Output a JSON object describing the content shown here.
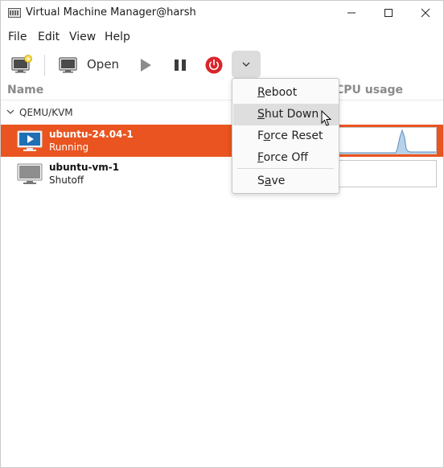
{
  "window": {
    "title": "Virtual Machine Manager@harsh",
    "icon": "vm-manager-icon",
    "controls": [
      "minimize-icon",
      "maximize-icon",
      "close-icon"
    ]
  },
  "menubar": {
    "items": [
      {
        "label": "File"
      },
      {
        "label": "Edit"
      },
      {
        "label": "View"
      },
      {
        "label": "Help"
      }
    ]
  },
  "toolbar": {
    "new_vm_icon": "new-vm-icon",
    "open_label": "Open",
    "run_icon": "play-icon",
    "pause_icon": "pause-icon",
    "shutdown_icon": "power-icon",
    "menu_icon": "chevron-down-icon",
    "shutdown_color": "#d9252a"
  },
  "columns": {
    "name": "Name",
    "cpu": "CPU usage"
  },
  "connection": {
    "label": "QEMU/KVM"
  },
  "vms": [
    {
      "name": "ubuntu-24.04-1",
      "status": "Running",
      "selected": true,
      "icon": "running-vm-icon"
    },
    {
      "name": "ubuntu-vm-1",
      "status": "Shutoff",
      "selected": false,
      "icon": "shutoff-vm-icon"
    }
  ],
  "selection_color": "#e95420",
  "shutdown_menu": {
    "items": [
      {
        "label": "Reboot",
        "mnemonic": "R"
      },
      {
        "label": "Shut Down",
        "mnemonic": "S",
        "hover": true
      },
      {
        "label": "Force Reset",
        "mnemonic": "o"
      },
      {
        "label": "Force Off",
        "mnemonic": "F"
      },
      {
        "label": "Save",
        "mnemonic": "a"
      }
    ]
  }
}
